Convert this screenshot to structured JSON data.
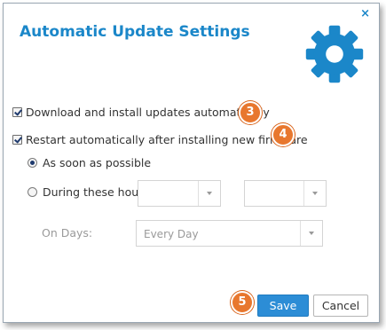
{
  "dialog": {
    "title": "Automatic Update Settings",
    "close_glyph": "×",
    "icon": "gear-icon",
    "accent": "#1b87c9"
  },
  "options": {
    "download": {
      "label": "Download and install updates automatically",
      "checked": true,
      "badge": "3"
    },
    "restart": {
      "label": "Restart automatically after installing new firmware",
      "checked": true,
      "badge": "4"
    }
  },
  "schedule": {
    "asap_label": "As soon as possible",
    "asap_selected": true,
    "hours_label": "During these hours",
    "hours_from": "",
    "hours_to": "",
    "days_label": "On Days:",
    "days_value": "Every Day"
  },
  "actions": {
    "save_label": "Save",
    "cancel_label": "Cancel",
    "badge": "5",
    "badge_color": "#e8772e"
  }
}
